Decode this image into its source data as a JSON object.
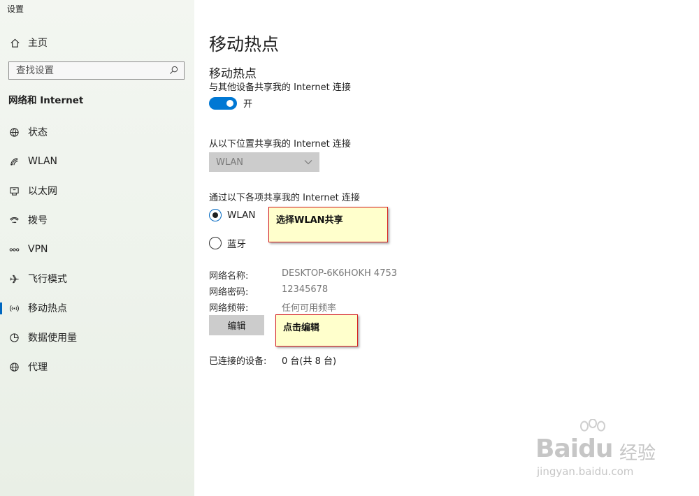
{
  "window": {
    "title": "设置"
  },
  "sidebar": {
    "home_label": "主页",
    "search_placeholder": "查找设置",
    "section_title": "网络和 Internet",
    "items": [
      {
        "label": "状态",
        "icon": "globe-status-icon",
        "active": false
      },
      {
        "label": "WLAN",
        "icon": "wifi-icon",
        "active": false
      },
      {
        "label": "以太网",
        "icon": "ethernet-icon",
        "active": false
      },
      {
        "label": "拨号",
        "icon": "dialup-icon",
        "active": false
      },
      {
        "label": "VPN",
        "icon": "vpn-icon",
        "active": false
      },
      {
        "label": "飞行模式",
        "icon": "airplane-icon",
        "active": false
      },
      {
        "label": "移动热点",
        "icon": "hotspot-icon",
        "active": true
      },
      {
        "label": "数据使用量",
        "icon": "data-usage-icon",
        "active": false
      },
      {
        "label": "代理",
        "icon": "proxy-globe-icon",
        "active": false
      }
    ]
  },
  "main": {
    "page_title": "移动热点",
    "sub_title": "移动热点",
    "share_desc": "与其他设备共享我的 Internet 连接",
    "toggle_state": "开",
    "from_label": "从以下位置共享我的 Internet 连接",
    "from_select_value": "WLAN",
    "via_label": "通过以下各项共享我的 Internet 连接",
    "radio_options": [
      {
        "label": "WLAN",
        "checked": true
      },
      {
        "label": "蓝牙",
        "checked": false
      }
    ],
    "network_name_label": "网络名称:",
    "network_name_value": "DESKTOP-6K6HOKH 4753",
    "network_password_label": "网络密码:",
    "network_password_value": "12345678",
    "network_band_label": "网络频带:",
    "network_band_value": "任何可用频率",
    "edit_button": "编辑",
    "connected_label": "已连接的设备:",
    "connected_value": "0 台(共 8 台)"
  },
  "annotations": {
    "callout_wlan": "选择WLAN共享",
    "callout_edit": "点击编辑"
  },
  "watermark": {
    "logo_text": "Bai",
    "logo_text_2": "du",
    "cn_text": "经验",
    "url": "jingyan.baidu.com"
  },
  "colors": {
    "accent": "#0078d4",
    "callout_bg": "#ffffcc",
    "callout_border": "#d41b1b"
  }
}
